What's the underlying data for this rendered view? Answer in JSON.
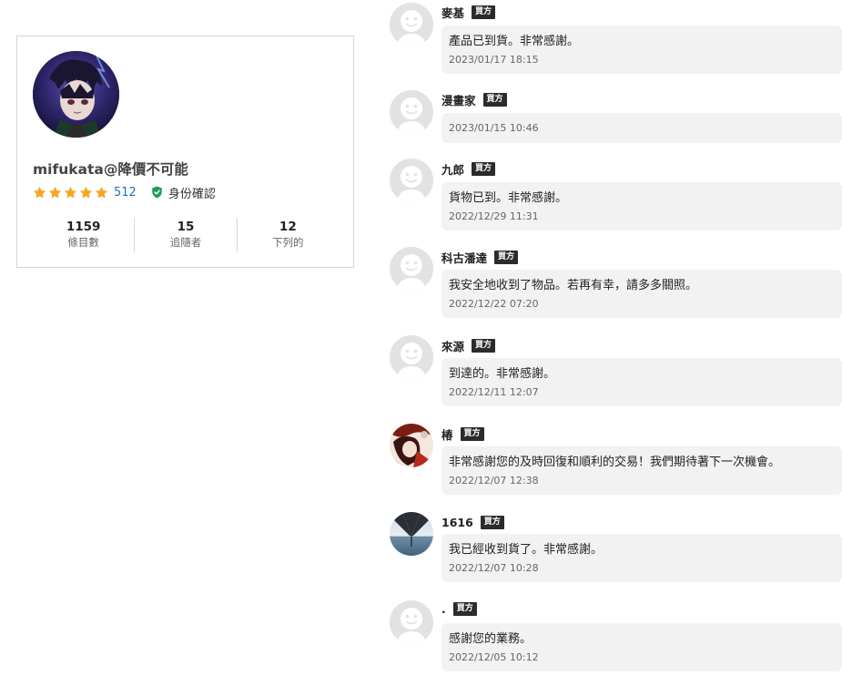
{
  "profile": {
    "username": "mifukata@降價不可能",
    "rating_stars": 5,
    "rating_count": "512",
    "verified_label": "身份確認",
    "stats": [
      {
        "value": "1159",
        "label": "條目數"
      },
      {
        "value": "15",
        "label": "追隨者"
      },
      {
        "value": "12",
        "label": "下列的"
      }
    ]
  },
  "reviews": [
    {
      "name": "麥基",
      "role": "買方",
      "text": "產品已到貨。非常感謝。",
      "time": "2023/01/17 18:15",
      "avatar": "default-avatar-icon"
    },
    {
      "name": "漫畫家",
      "role": "買方",
      "text": "",
      "time": "2023/01/15 10:46",
      "avatar": "default-avatar-icon"
    },
    {
      "name": "九郎",
      "role": "買方",
      "text": "貨物已到。非常感謝。",
      "time": "2022/12/29 11:31",
      "avatar": "default-avatar-icon"
    },
    {
      "name": "科古潘達",
      "role": "買方",
      "text": "我安全地收到了物品。若再有幸，請多多關照。",
      "time": "2022/12/22 07:20",
      "avatar": "default-avatar-icon"
    },
    {
      "name": "來源",
      "role": "買方",
      "text": "到達的。非常感謝。",
      "time": "2022/12/11 12:07",
      "avatar": "default-avatar-icon"
    },
    {
      "name": "椿",
      "role": "買方",
      "text": "非常感謝您的及時回復和順利的交易！我們期待著下一次機會。",
      "time": "2022/12/07 12:38",
      "avatar": "photo-avatar"
    },
    {
      "name": "1616",
      "role": "買方",
      "text": "我已經收到貨了。非常感謝。",
      "time": "2022/12/07 10:28",
      "avatar": "photo-avatar"
    },
    {
      "name": ".",
      "role": "買方",
      "text": "感謝您的業務。",
      "time": "2022/12/05 10:12",
      "avatar": "default-avatar-icon"
    }
  ],
  "colors": {
    "star": "#f5a623",
    "rating_link": "#1a73c9",
    "verified_shield": "#1f9d55",
    "badge_bg": "#2b2b2b",
    "bubble_bg": "#f2f2f2"
  }
}
